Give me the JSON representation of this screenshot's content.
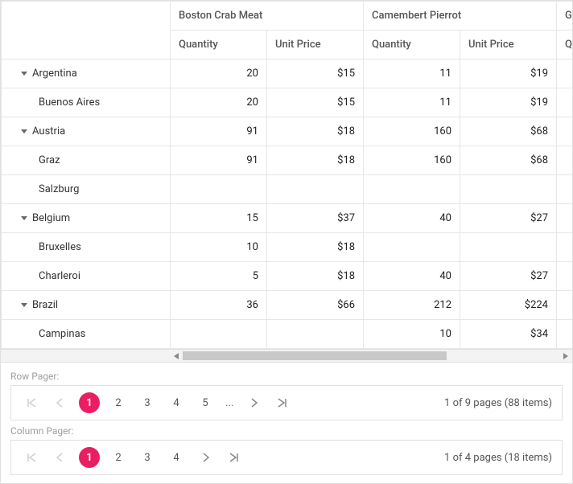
{
  "colors": {
    "accent": "#e91e63"
  },
  "columns": {
    "groups": [
      {
        "label": "Boston Crab Meat",
        "sub": [
          "Quantity",
          "Unit Price"
        ]
      },
      {
        "label": "Camembert Pierrot",
        "sub": [
          "Quantity",
          "Unit Price"
        ]
      },
      {
        "label": "G",
        "sub": [
          "Q"
        ]
      }
    ]
  },
  "rows": [
    {
      "type": "country",
      "label": "Argentina",
      "cells": [
        "20",
        "$15",
        "11",
        "$19",
        ""
      ]
    },
    {
      "type": "city",
      "label": "Buenos Aires",
      "cells": [
        "20",
        "$15",
        "11",
        "$19",
        ""
      ]
    },
    {
      "type": "country",
      "label": "Austria",
      "cells": [
        "91",
        "$18",
        "160",
        "$68",
        ""
      ]
    },
    {
      "type": "city",
      "label": "Graz",
      "cells": [
        "91",
        "$18",
        "160",
        "$68",
        ""
      ]
    },
    {
      "type": "city",
      "label": "Salzburg",
      "cells": [
        "",
        "",
        "",
        "",
        ""
      ]
    },
    {
      "type": "country",
      "label": "Belgium",
      "cells": [
        "15",
        "$37",
        "40",
        "$27",
        ""
      ]
    },
    {
      "type": "city",
      "label": "Bruxelles",
      "cells": [
        "10",
        "$18",
        "",
        "",
        ""
      ]
    },
    {
      "type": "city",
      "label": "Charleroi",
      "cells": [
        "5",
        "$18",
        "40",
        "$27",
        ""
      ]
    },
    {
      "type": "country",
      "label": "Brazil",
      "cells": [
        "36",
        "$66",
        "212",
        "$224",
        ""
      ]
    },
    {
      "type": "city",
      "label": "Campinas",
      "cells": [
        "",
        "",
        "10",
        "$34",
        ""
      ]
    }
  ],
  "pagers": {
    "row": {
      "label": "Row Pager:",
      "pages": [
        "1",
        "2",
        "3",
        "4",
        "5"
      ],
      "active": "1",
      "has_ellipsis": true,
      "info": "1 of 9 pages (88 items)"
    },
    "column": {
      "label": "Column Pager:",
      "pages": [
        "1",
        "2",
        "3",
        "4"
      ],
      "active": "1",
      "has_ellipsis": false,
      "info": "1 of 4 pages (18 items)"
    }
  }
}
